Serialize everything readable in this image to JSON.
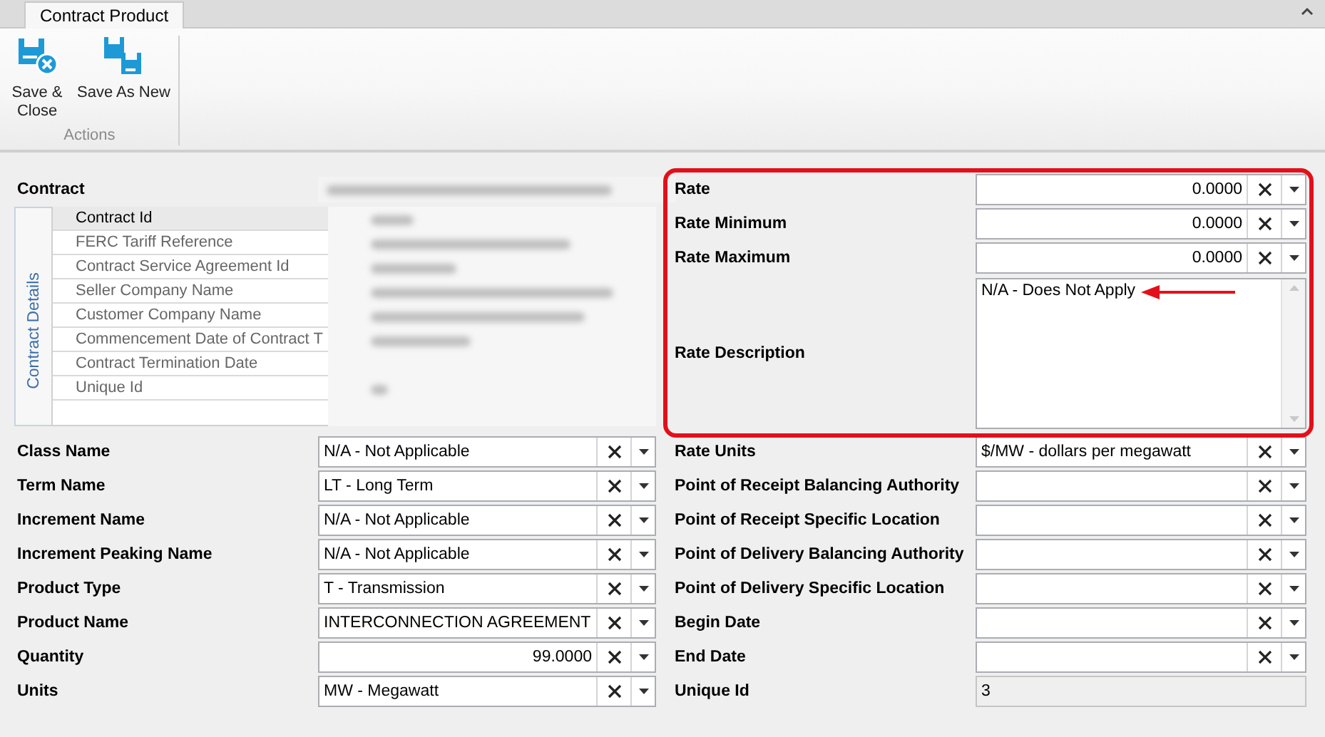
{
  "tab": {
    "label": "Contract Product",
    "selected": true
  },
  "ribbon": {
    "buttons": [
      {
        "label": "Save & Close",
        "kind": "save-close"
      },
      {
        "label": "Save As New",
        "kind": "save-new"
      }
    ],
    "group": "Actions"
  },
  "contract": {
    "label": "Contract",
    "details_title": "Contract Details",
    "details": [
      {
        "label": "Contract Id",
        "selected": true
      },
      {
        "label": "FERC Tariff Reference",
        "selected": false
      },
      {
        "label": "Contract Service Agreement Id",
        "selected": false
      },
      {
        "label": "Seller Company Name",
        "selected": false
      },
      {
        "label": "Customer Company Name",
        "selected": false
      },
      {
        "label": "Commencement Date of Contract T",
        "selected": false
      },
      {
        "label": "Contract Termination Date",
        "selected": false
      },
      {
        "label": "Unique Id",
        "selected": false
      }
    ]
  },
  "left_fields": [
    {
      "label": "Class Name",
      "value": "N/A - Not Applicable",
      "kind": "combo"
    },
    {
      "label": "Term Name",
      "value": "LT - Long Term",
      "kind": "combo"
    },
    {
      "label": "Increment Name",
      "value": "N/A - Not Applicable",
      "kind": "combo"
    },
    {
      "label": "Increment Peaking Name",
      "value": "N/A - Not Applicable",
      "kind": "combo"
    },
    {
      "label": "Product Type",
      "value": "T - Transmission",
      "kind": "combo"
    },
    {
      "label": "Product Name",
      "value": "INTERCONNECTION AGREEMENT",
      "kind": "combo"
    },
    {
      "label": "Quantity",
      "value": "99.0000",
      "kind": "number"
    },
    {
      "label": "Units",
      "value": "MW - Megawatt",
      "kind": "combo"
    }
  ],
  "rate_fields": [
    {
      "label": "Rate",
      "value": "0.0000",
      "kind": "number"
    },
    {
      "label": "Rate Minimum",
      "value": "0.0000",
      "kind": "number"
    },
    {
      "label": "Rate Maximum",
      "value": "0.0000",
      "kind": "number"
    },
    {
      "label": "Rate Description",
      "value": "N/A - Does Not Apply",
      "kind": "memo"
    }
  ],
  "right_fields": [
    {
      "label": "Rate Units",
      "value": "$/MW - dollars per megawatt",
      "kind": "combo"
    },
    {
      "label": "Point of Receipt Balancing Authority",
      "kind": "combo"
    },
    {
      "label": "Point of Receipt Specific Location",
      "kind": "combo"
    },
    {
      "label": "Point of Delivery Balancing Authority",
      "kind": "combo"
    },
    {
      "label": "Point of Delivery Specific Location",
      "kind": "combo"
    },
    {
      "label": "Begin Date",
      "kind": "combo"
    },
    {
      "label": "End Date",
      "kind": "combo"
    },
    {
      "label": "Unique Id",
      "value": "3",
      "kind": "readonly"
    }
  ]
}
